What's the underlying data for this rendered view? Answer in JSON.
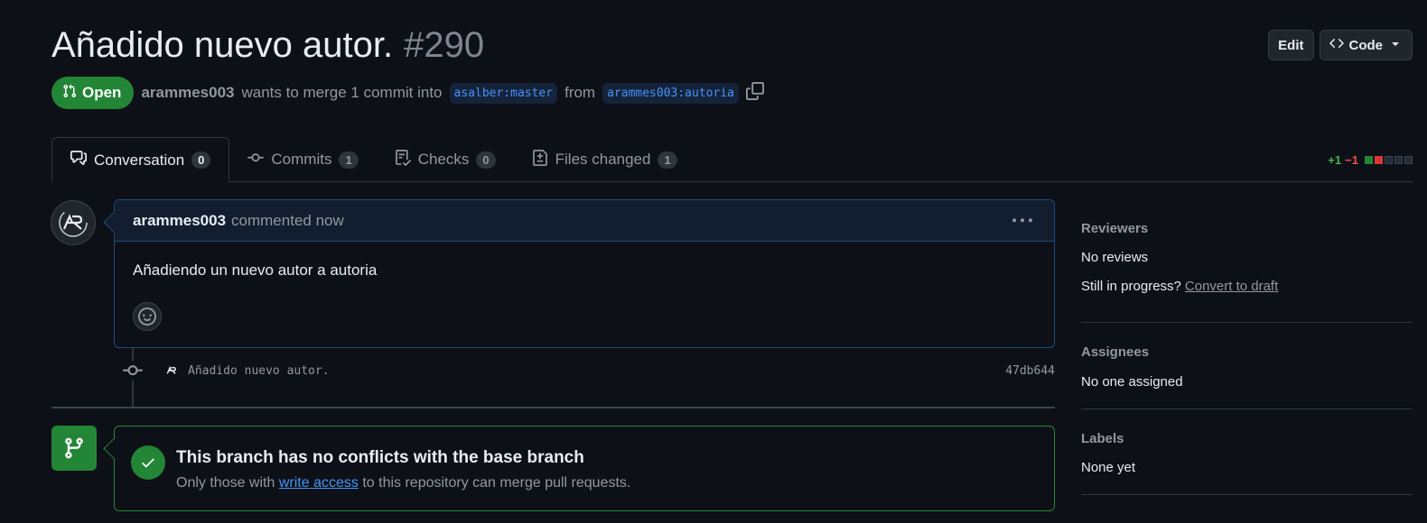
{
  "header": {
    "title": "Añadido nuevo autor.",
    "number": "#290",
    "edit_label": "Edit",
    "code_label": "Code"
  },
  "meta": {
    "state": "Open",
    "author": "arammes003",
    "merge_text": "wants to merge 1 commit into",
    "base_branch": "asalber:master",
    "from_text": "from",
    "head_branch": "arammes003:autoria"
  },
  "tabs": [
    {
      "label": "Conversation",
      "count": "0",
      "icon": "comment-discussion-icon"
    },
    {
      "label": "Commits",
      "count": "1",
      "icon": "git-commit-icon"
    },
    {
      "label": "Checks",
      "count": "0",
      "icon": "checklist-icon"
    },
    {
      "label": "Files changed",
      "count": "1",
      "icon": "file-diff-icon"
    }
  ],
  "diffstat": {
    "additions": "+1",
    "deletions": "−1"
  },
  "comment": {
    "author": "arammes003",
    "time": "commented now",
    "body": "Añadiendo un nuevo autor a autoria"
  },
  "commit": {
    "message": "Añadido nuevo autor.",
    "sha": "47db644"
  },
  "merge": {
    "title": "This branch has no conflicts with the base branch",
    "sub_before": "Only those with",
    "sub_link": "write access",
    "sub_after": "to this repository can merge pull requests."
  },
  "sidebar": {
    "reviewers_heading": "Reviewers",
    "reviewers_value": "No reviews",
    "in_progress": "Still in progress?",
    "convert_draft": "Convert to draft",
    "assignees_heading": "Assignees",
    "assignees_value": "No one assigned",
    "labels_heading": "Labels",
    "labels_value": "None yet"
  },
  "colors": {
    "accent": "#238636",
    "link": "#4493f8",
    "background": "#0d1117"
  }
}
